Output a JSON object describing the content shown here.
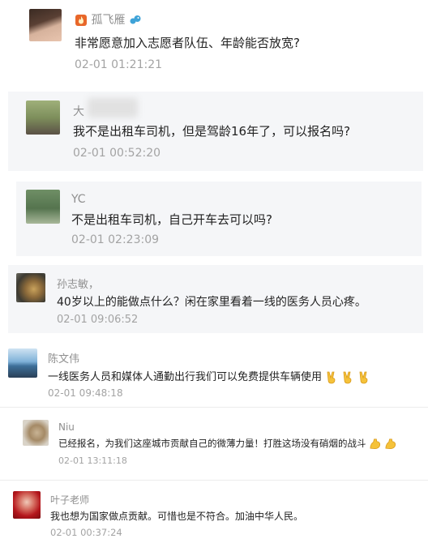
{
  "comments": [
    {
      "name": "孤飞雁",
      "text": "非常愿意加入志愿者队伍、年龄能否放宽?",
      "time": "02-01 01:21:21"
    },
    {
      "name": "大",
      "text": "我不是出租车司机，但是驾龄16年了，可以报名吗?",
      "time": "02-01 00:52:20"
    },
    {
      "name": "YC",
      "text": "不是出租车司机，自己开车去可以吗?",
      "time": "02-01 02:23:09"
    },
    {
      "name": "孙志敏，",
      "text": "40岁以上的能做点什么？闲在家里看着一线的医务人员心疼。",
      "time": "02-01 09:06:52"
    },
    {
      "name": "陈文伟",
      "text": "一线医务人员和媒体人通勤出行我们可以免费提供车辆使用",
      "time": "02-01 09:48:18"
    },
    {
      "name": "Niu",
      "text": "已经报名，为我们这座城市贡献自己的微薄力量！打胜这场没有硝烟的战斗",
      "time": "02-01 13:11:18"
    },
    {
      "name": "叶子老师",
      "text": "我也想为国家做点贡献。可惜也是不符合。加油中华人民。",
      "time": "02-01 00:37:24"
    }
  ],
  "icons": {
    "flame": "flame-icon",
    "bird": "bird-icon",
    "victory": "victory-hand-emoji",
    "muscle": "flexed-biceps-emoji"
  },
  "colors": {
    "card_bg": "#f5f6f8",
    "name_text": "#8f8f8f",
    "time_text": "#a3a3a3",
    "message_text": "#222222"
  }
}
